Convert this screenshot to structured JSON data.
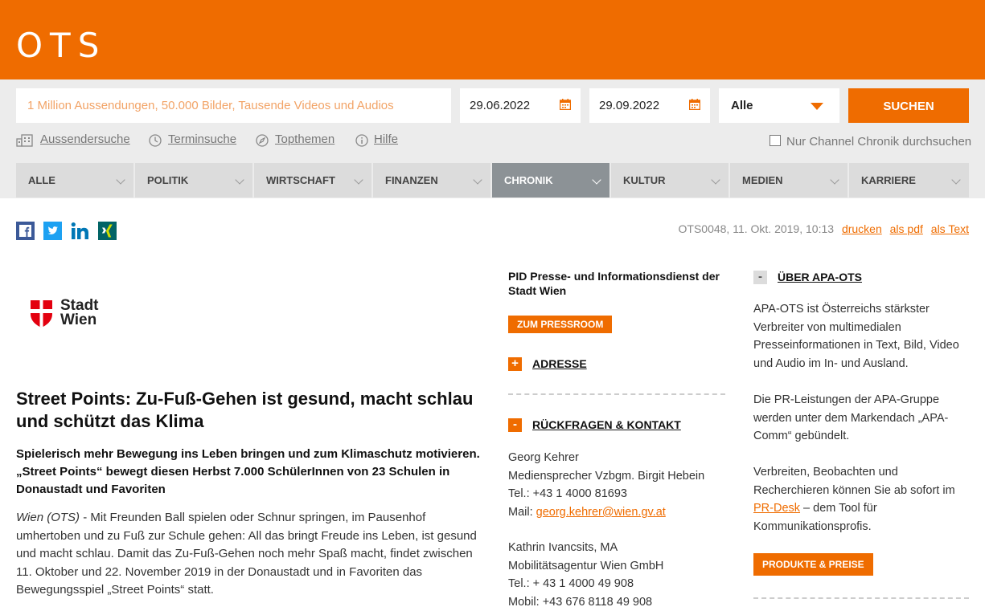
{
  "header": {
    "logo": "OTS"
  },
  "search": {
    "placeholder": "1 Million Aussendungen, 50.000 Bilder, Tausende Videos und Audios",
    "date_from": "29.06.2022",
    "date_to": "29.09.2022",
    "select_value": "Alle",
    "button": "SUCHEN",
    "links": [
      "Aussendersuche",
      "Terminsuche",
      "Topthemen",
      "Hilfe"
    ],
    "channel_checkbox": "Nur Channel Chronik durchsuchen"
  },
  "nav": [
    "ALLE",
    "POLITIK",
    "WIRTSCHAFT",
    "FINANZEN",
    "CHRONIK",
    "KULTUR",
    "MEDIEN",
    "KARRIERE"
  ],
  "nav_active": "CHRONIK",
  "meta": {
    "info": "OTS0048, 11. Okt. 2019, 10:13",
    "print": "drucken",
    "pdf": "als pdf",
    "text": "als Text"
  },
  "social": [
    "facebook-icon",
    "twitter-icon",
    "linkedin-icon",
    "xing-icon"
  ],
  "article": {
    "logo_line1": "Stadt",
    "logo_line2": "Wien",
    "title": "Street Points: Zu-Fuß-Gehen ist gesund, macht schlau und schützt das Klima",
    "lead": "Spielerisch mehr Bewegung ins Leben bringen und zum Klimaschutz motivieren. „Street Points“ bewegt diesen Herbst 7.000 SchülerInnen von 23 Schulen in Donaustadt und Favoriten",
    "dateline": "Wien (OTS)",
    "body": " - Mit Freunden Ball spielen oder Schnur springen, im Pausenhof umhertoben und zu Fuß zur Schule gehen: All das bringt Freude ins Leben, ist gesund und macht schlau. Damit das Zu-Fuß-Gehen noch mehr Spaß macht, findet zwischen 11. Oktober und 22. November 2019 in der Donaustadt und in Favoriten das Bewegungsspiel „Street Points“ statt."
  },
  "sidebar": {
    "sender": "PID Presse- und Informationsdienst der Stadt Wien",
    "pressroom_btn": "ZUM PRESSROOM",
    "address": "ADRESSE",
    "contact_title": "RÜCKFRAGEN & KONTAKT",
    "contacts": [
      [
        "Georg Kehrer",
        "Mediensprecher Vzbgm. Birgit Hebein",
        "Tel.: +43 1 4000 81693"
      ],
      [
        "Kathrin Ivancsits, MA",
        "Mobilitätsagentur Wien GmbH",
        "Tel.: + 43 1 4000 49 908",
        "Mobil: +43 676 8118 49 908"
      ]
    ],
    "mail_label": "Mail: ",
    "mail": "georg.kehrer@wien.gv.at"
  },
  "about": {
    "title": "ÜBER APA-OTS",
    "p1": "APA-OTS ist Österreichs stärkster Verbreiter von multimedialen Presseinformationen in Text, Bild, Video und Audio im In- und Ausland.",
    "p2": "Die PR-Leistungen der APA-Gruppe werden unter dem Markendach „APA-Comm“ gebündelt.",
    "p3_a": "Verbreiten, Beobachten und Recherchieren können Sie ab sofort im ",
    "p3_link": "PR-Desk",
    "p3_b": " – dem Tool für Kommunikationsprofis.",
    "button": "PRODUKTE & PREISE"
  },
  "colors": {
    "accent": "#ef6c00",
    "nav_active": "#8c9296"
  }
}
